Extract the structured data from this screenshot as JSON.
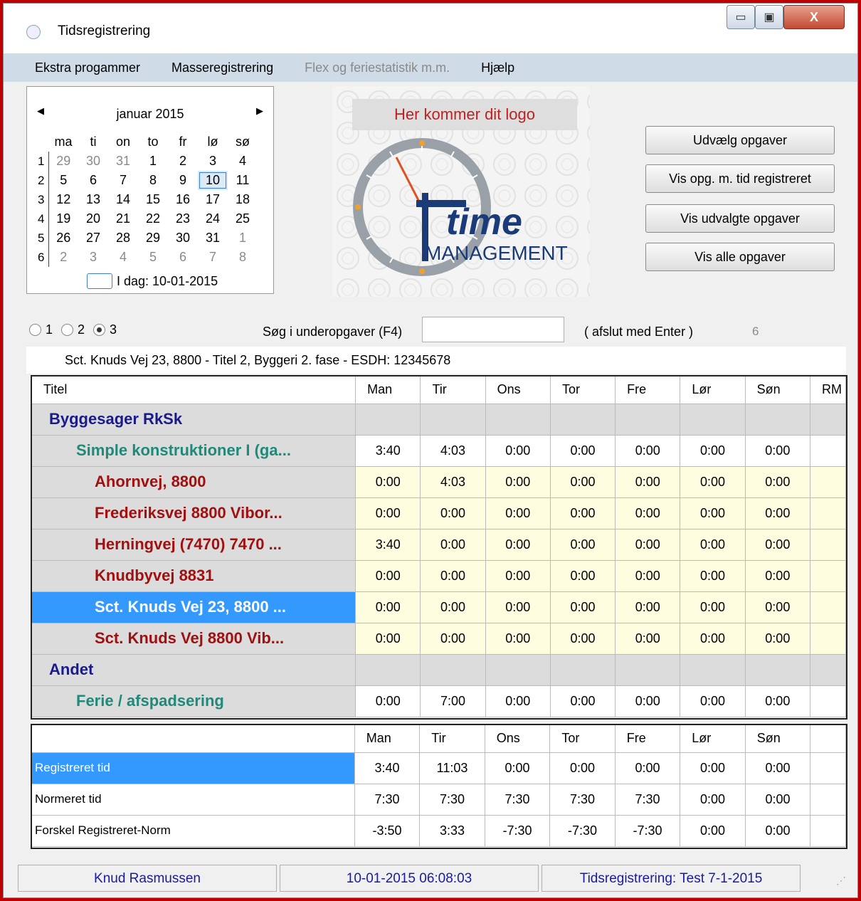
{
  "window": {
    "title": "Tidsregistrering",
    "min_glyph": "▭",
    "max_glyph": "▣",
    "close_glyph": "X"
  },
  "menu": [
    "Ekstra progammer",
    "Masseregistrering",
    "Flex og feriestatistik m.m.",
    "Hjælp"
  ],
  "calendar": {
    "month": "januar 2015",
    "prev": "◀",
    "next": "▶",
    "weekdays": [
      "ma",
      "ti",
      "on",
      "to",
      "fr",
      "lø",
      "sø"
    ],
    "weeks": [
      {
        "wk": "1",
        "days": [
          "29",
          "30",
          "31",
          "1",
          "2",
          "3",
          "4"
        ]
      },
      {
        "wk": "2",
        "days": [
          "5",
          "6",
          "7",
          "8",
          "9",
          "10",
          "11"
        ]
      },
      {
        "wk": "3",
        "days": [
          "12",
          "13",
          "14",
          "15",
          "16",
          "17",
          "18"
        ]
      },
      {
        "wk": "4",
        "days": [
          "19",
          "20",
          "21",
          "22",
          "23",
          "24",
          "25"
        ]
      },
      {
        "wk": "5",
        "days": [
          "26",
          "27",
          "28",
          "29",
          "30",
          "31",
          "1"
        ]
      },
      {
        "wk": "6",
        "days": [
          "2",
          "3",
          "4",
          "5",
          "6",
          "7",
          "8"
        ]
      }
    ],
    "today_label": "I dag: 10-01-2015"
  },
  "logo": {
    "band_text": "Her kommer dit logo",
    "word1": "time",
    "word2": "MANAGEMENT"
  },
  "buttons": {
    "select_tasks": "Udvælg opgaver",
    "show_registered": "Vis opg. m. tid registreret",
    "show_selected": "Vis udvalgte opgaver",
    "show_all": "Vis alle opgaver"
  },
  "levels": {
    "options": [
      "1",
      "2",
      "3"
    ],
    "selected": "3"
  },
  "search": {
    "label": "Søg i underopgaver (F4)",
    "value": "",
    "hint": "( afslut med Enter )",
    "count": "6"
  },
  "path": "Sct. Knuds Vej 23, 8800 - Titel 2, Byggeri 2. fase - ESDH: 12345678",
  "task_grid": {
    "headers": [
      "Titel",
      "Man",
      "Tir",
      "Ons",
      "Tor",
      "Fre",
      "Lør",
      "Søn",
      "RM"
    ],
    "rows": [
      {
        "level": "cat",
        "title": "Byggesager RkSk",
        "values": [
          "",
          "",
          "",
          "",
          "",
          "",
          ""
        ]
      },
      {
        "level": "sub",
        "title": "Simple konstruktioner I (ga...",
        "values": [
          "3:40",
          "4:03",
          "0:00",
          "0:00",
          "0:00",
          "0:00",
          "0:00"
        ]
      },
      {
        "level": "leaf",
        "title": "Ahornvej, 8800",
        "values": [
          "0:00",
          "4:03",
          "0:00",
          "0:00",
          "0:00",
          "0:00",
          "0:00"
        ]
      },
      {
        "level": "leaf",
        "title": "Frederiksvej 8800 Vibor...",
        "values": [
          "0:00",
          "0:00",
          "0:00",
          "0:00",
          "0:00",
          "0:00",
          "0:00"
        ]
      },
      {
        "level": "leaf",
        "title": "Herningvej (7470) 7470 ...",
        "values": [
          "3:40",
          "0:00",
          "0:00",
          "0:00",
          "0:00",
          "0:00",
          "0:00"
        ]
      },
      {
        "level": "leaf",
        "title": "Knudbyvej 8831",
        "values": [
          "0:00",
          "0:00",
          "0:00",
          "0:00",
          "0:00",
          "0:00",
          "0:00"
        ]
      },
      {
        "level": "leaf sel",
        "title": "Sct. Knuds Vej 23, 8800 ...",
        "values": [
          "0:00",
          "0:00",
          "0:00",
          "0:00",
          "0:00",
          "0:00",
          "0:00"
        ]
      },
      {
        "level": "leaf",
        "title": "Sct. Knuds Vej 8800 Vib...",
        "values": [
          "0:00",
          "0:00",
          "0:00",
          "0:00",
          "0:00",
          "0:00",
          "0:00"
        ]
      },
      {
        "level": "cat",
        "title": "Andet",
        "values": [
          "",
          "",
          "",
          "",
          "",
          "",
          ""
        ]
      },
      {
        "level": "sub",
        "title": "Ferie / afspadsering",
        "values": [
          "0:00",
          "7:00",
          "0:00",
          "0:00",
          "0:00",
          "0:00",
          "0:00"
        ]
      }
    ]
  },
  "summary_grid": {
    "headers": [
      "",
      "Man",
      "Tir",
      "Ons",
      "Tor",
      "Fre",
      "Lør",
      "Søn"
    ],
    "rows": [
      {
        "label": "Registreret tid",
        "highlight": true,
        "values": [
          "3:40",
          "11:03",
          "0:00",
          "0:00",
          "0:00",
          "0:00",
          "0:00"
        ]
      },
      {
        "label": "Normeret tid",
        "highlight": false,
        "values": [
          "7:30",
          "7:30",
          "7:30",
          "7:30",
          "7:30",
          "0:00",
          "0:00"
        ]
      },
      {
        "label": "Forskel Registreret-Norm",
        "highlight": false,
        "values": [
          "-3:50",
          "3:33",
          "-7:30",
          "-7:30",
          "-7:30",
          "0:00",
          "0:00"
        ]
      }
    ]
  },
  "status": {
    "user": "Knud Rasmussen",
    "datetime": "10-01-2015 06:08:03",
    "app": "Tidsregistrering: Test 7-1-2015"
  },
  "colors": {
    "selection": "#3399ff",
    "leaf_bg": "#fffde0",
    "accent_red": "#c00000"
  }
}
